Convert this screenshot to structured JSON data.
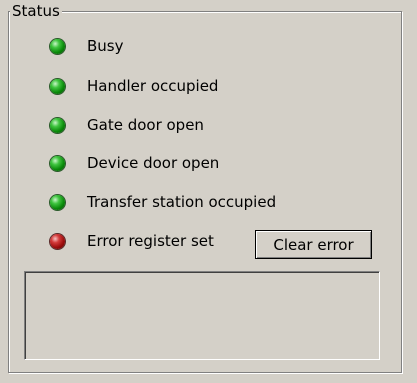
{
  "status_group": {
    "title": "Status",
    "indicators": [
      {
        "label": "Busy",
        "state": "green"
      },
      {
        "label": "Handler occupied",
        "state": "green"
      },
      {
        "label": "Gate door open",
        "state": "green"
      },
      {
        "label": "Device door open",
        "state": "green"
      },
      {
        "label": "Transfer station occupied",
        "state": "green"
      },
      {
        "label": "Error register set",
        "state": "red"
      }
    ],
    "clear_error_label": "Clear error"
  },
  "colors": {
    "background": "#d4d0c8",
    "led_green": "#0a8a0a",
    "led_red": "#9b0c0c"
  }
}
